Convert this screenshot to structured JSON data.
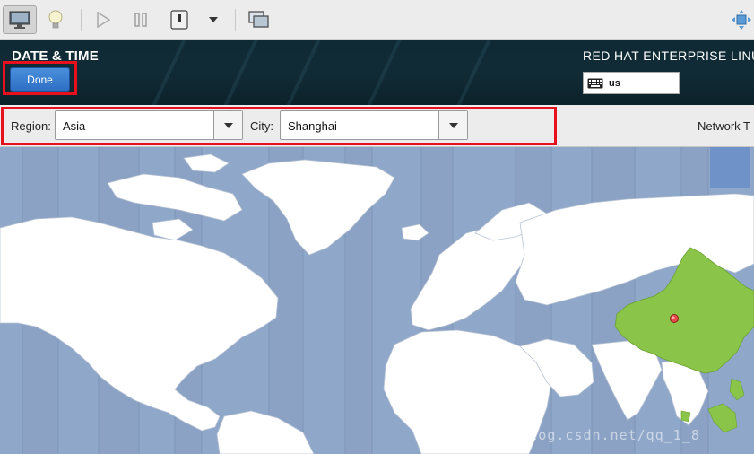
{
  "header": {
    "page_title": "DATE & TIME",
    "done_label": "Done",
    "product_title": "RED HAT ENTERPRISE LINU",
    "keyboard_layout": "us"
  },
  "selector": {
    "region_label": "Region:",
    "region_value": "Asia",
    "city_label": "City:",
    "city_value": "Shanghai",
    "network_time_label": "Network T"
  },
  "map": {
    "selected_zone_color": "#8ac54a",
    "land_color": "#ffffff",
    "ocean_color": "#8fa7c9",
    "marker_color": "#e84a4a"
  },
  "watermark": "https://blog.csdn.net/qq_1_8"
}
